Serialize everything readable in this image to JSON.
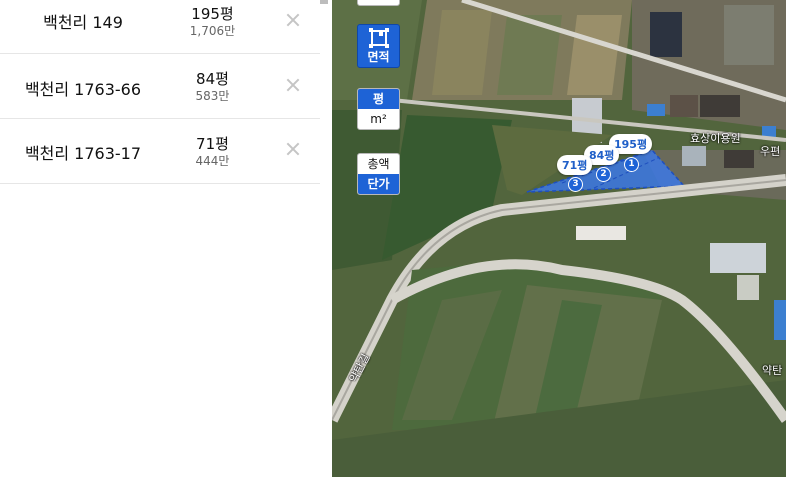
{
  "parcels": [
    {
      "address": "백천리 149",
      "area": "195평",
      "price": "1,706만"
    },
    {
      "address": "백천리 1763-66",
      "area": "84평",
      "price": "583만"
    },
    {
      "address": "백천리 1763-17",
      "area": "71평",
      "price": "444만"
    }
  ],
  "map_controls": {
    "area_tool_label": "면적",
    "unit_pyeong": "평",
    "unit_m2": "m²",
    "total_price": "총액",
    "unit_price": "단가"
  },
  "map_markers": [
    {
      "area": "195평",
      "number": "1"
    },
    {
      "area": "84평",
      "number": "2"
    },
    {
      "area": "71평",
      "number": "3"
    }
  ],
  "map_labels": {
    "road_1": "약탄길",
    "road_right": "약탄",
    "place_top": "효상이용원",
    "place_right": "우편"
  },
  "colors": {
    "accent": "#1e63d6",
    "selection_fill": "#3c78e6"
  }
}
